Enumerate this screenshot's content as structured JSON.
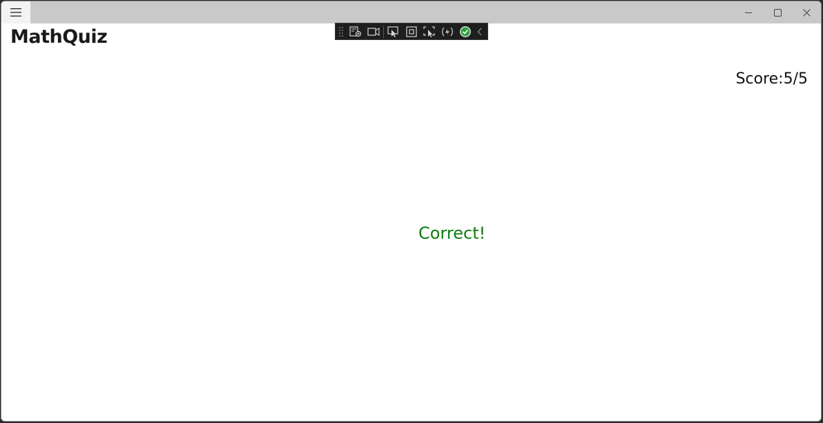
{
  "window": {
    "title": "MathQuiz",
    "controls": {
      "minimize_icon": "minimize-icon",
      "maximize_icon": "maximize-icon",
      "close_icon": "close-icon"
    }
  },
  "debug_toolbar": {
    "buttons": [
      "live-visual-tree-icon",
      "record-icon",
      "select-element-icon",
      "display-layout-adorners-icon",
      "track-focus-icon",
      "hot-reload-icon",
      "status-ok-icon",
      "collapse-chevron-icon"
    ]
  },
  "quiz": {
    "score_label": "Score:5/5",
    "result_message": "Correct!"
  },
  "colors": {
    "result_color": "#107c10",
    "titlebar": "#c9c9c9",
    "toolbar_bg": "#1e1e1e",
    "ok_green": "#2ea043"
  }
}
